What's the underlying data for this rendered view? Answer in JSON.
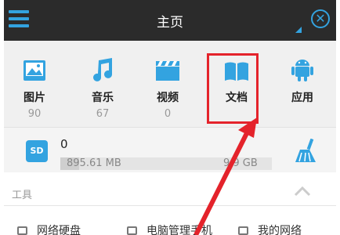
{
  "header": {
    "title": "主页",
    "menu_icon": "menu-icon",
    "close_icon": "close-circle-icon",
    "accent": "#33a3e0"
  },
  "categories": [
    {
      "label": "图片",
      "count": "90",
      "icon": "image-icon"
    },
    {
      "label": "音乐",
      "count": "67",
      "icon": "music-note-icon"
    },
    {
      "label": "视频",
      "count": "0",
      "icon": "video-clapper-icon"
    },
    {
      "label": "文档",
      "count": "",
      "icon": "book-icon"
    },
    {
      "label": "应用",
      "count": "",
      "icon": "android-icon"
    }
  ],
  "storage": {
    "badge": "SD",
    "count": "0",
    "used": "895.61 MB",
    "total": "9.9 GB",
    "used_fraction": 0.09
  },
  "tools": {
    "section_label": "工具",
    "items": [
      {
        "label": "网络硬盘"
      },
      {
        "label": "电脑管理手机"
      },
      {
        "label": "我的网络"
      }
    ]
  },
  "annotation": {
    "highlight_color": "#e4232b"
  }
}
